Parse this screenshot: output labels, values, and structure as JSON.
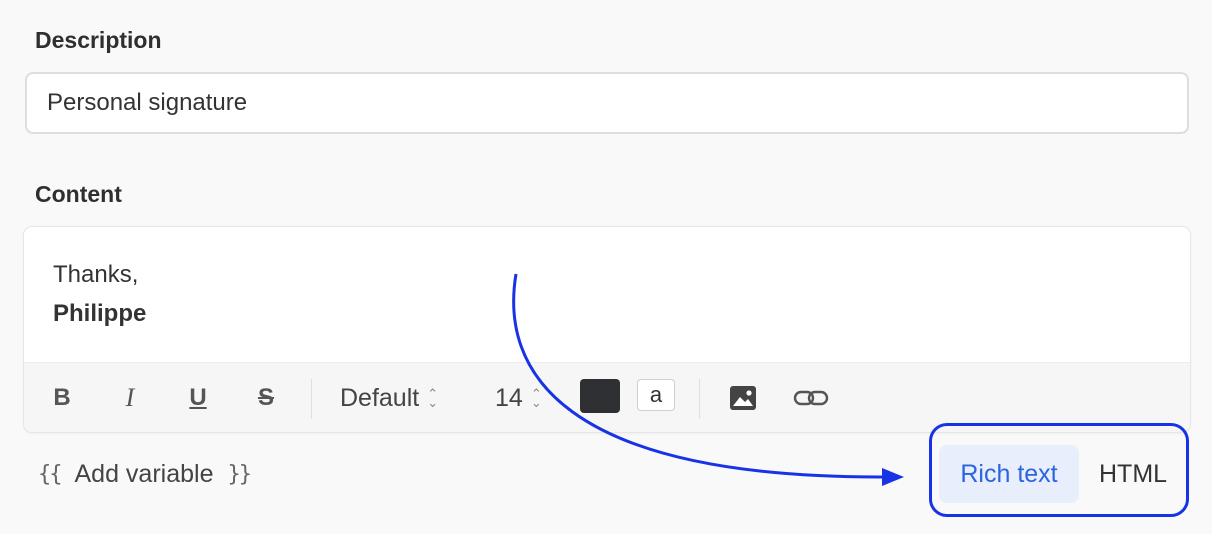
{
  "description": {
    "label": "Description",
    "value": "Personal signature"
  },
  "content": {
    "label": "Content",
    "lines": [
      "Thanks,",
      "Philippe"
    ]
  },
  "toolbar": {
    "bold": "B",
    "italic": "I",
    "underline": "U",
    "strikethrough": "S",
    "font": "Default",
    "size": "14",
    "text_color": "#2f3033",
    "bg_sample": "a",
    "image_icon": "image-icon",
    "link_icon": "link-icon"
  },
  "add_variable": {
    "open_brace": "{{",
    "label": "Add variable",
    "close_brace": "}}"
  },
  "mode": {
    "rich_text": "Rich text",
    "html": "HTML",
    "selected": "Rich text",
    "accent_color": "#2b63e0",
    "highlight_color": "#1833e6"
  }
}
